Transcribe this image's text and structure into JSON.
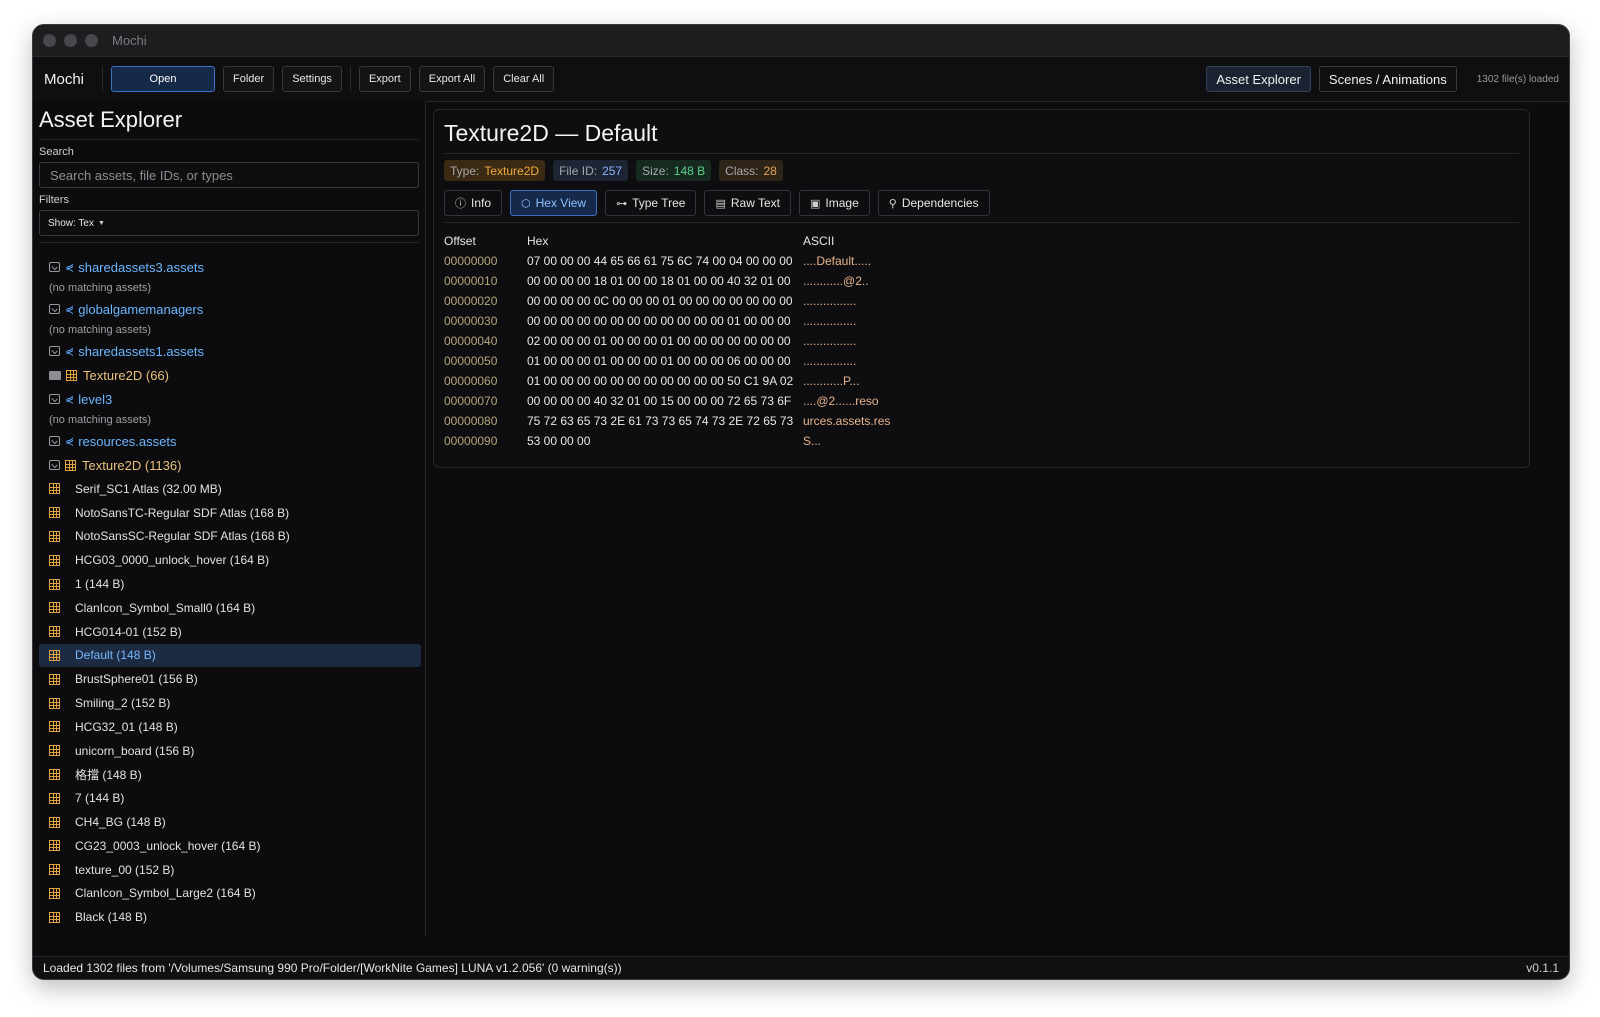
{
  "window": {
    "title": "Mochi"
  },
  "toolbar": {
    "brand": "Mochi",
    "open": "Open",
    "folder": "Folder",
    "settings": "Settings",
    "export": "Export",
    "export_all": "Export All",
    "clear_all": "Clear All",
    "asset_explorer": "Asset Explorer",
    "scenes_animations": "Scenes / Animations",
    "file_count": "1302 file(s) loaded"
  },
  "sidebar": {
    "title": "Asset Explorer",
    "search_label": "Search",
    "search_placeholder": "Search assets, file IDs, or types",
    "filters_label": "Filters",
    "filter_value": "Show: Tex",
    "tree": [
      {
        "kind": "file",
        "label": "sharedassets3.assets"
      },
      {
        "kind": "nomatch",
        "label": "(no matching assets)"
      },
      {
        "kind": "file",
        "label": "globalgamemanagers"
      },
      {
        "kind": "nomatch",
        "label": "(no matching assets)"
      },
      {
        "kind": "file",
        "label": "sharedassets1.assets"
      },
      {
        "kind": "group-closed",
        "label": "Texture2D (66)"
      },
      {
        "kind": "file",
        "label": "level3"
      },
      {
        "kind": "nomatch",
        "label": "(no matching assets)"
      },
      {
        "kind": "file",
        "label": "resources.assets"
      },
      {
        "kind": "group-open",
        "label": "Texture2D (1136)"
      },
      {
        "kind": "leaf",
        "label": "Serif_SC1 Atlas (32.00 MB)"
      },
      {
        "kind": "leaf",
        "label": "NotoSansTC-Regular SDF Atlas (168 B)"
      },
      {
        "kind": "leaf",
        "label": "NotoSansSC-Regular SDF Atlas (168 B)"
      },
      {
        "kind": "leaf",
        "label": "HCG03_0000_unlock_hover (164 B)"
      },
      {
        "kind": "leaf",
        "label": "1 (144 B)"
      },
      {
        "kind": "leaf",
        "label": "ClanIcon_Symbol_Small0 (164 B)"
      },
      {
        "kind": "leaf",
        "label": "HCG014-01 (152 B)"
      },
      {
        "kind": "leaf",
        "label": "Default (148 B)",
        "selected": true
      },
      {
        "kind": "leaf",
        "label": "BrustSphere01 (156 B)"
      },
      {
        "kind": "leaf",
        "label": "Smiling_2 (152 B)"
      },
      {
        "kind": "leaf",
        "label": "HCG32_01 (148 B)"
      },
      {
        "kind": "leaf",
        "label": "unicorn_board (156 B)"
      },
      {
        "kind": "leaf",
        "label": "格擋 (148 B)"
      },
      {
        "kind": "leaf",
        "label": "7 (144 B)"
      },
      {
        "kind": "leaf",
        "label": "CH4_BG (148 B)"
      },
      {
        "kind": "leaf",
        "label": "CG23_0003_unlock_hover (164 B)"
      },
      {
        "kind": "leaf",
        "label": "texture_00 (152 B)"
      },
      {
        "kind": "leaf",
        "label": "ClanIcon_Symbol_Large2 (164 B)"
      },
      {
        "kind": "leaf",
        "label": "Black (148 B)"
      }
    ]
  },
  "main": {
    "title": "Texture2D — Default",
    "badges": {
      "type_key": "Type:",
      "type_val": "Texture2D",
      "fid_key": "File ID:",
      "fid_val": "257",
      "size_key": "Size:",
      "size_val": "148 B",
      "class_key": "Class:",
      "class_val": "28"
    },
    "tabs": [
      {
        "icon": "info-icon",
        "glyph": "ⓘ",
        "label": "Info"
      },
      {
        "icon": "hex-icon",
        "glyph": "⬡",
        "label": "Hex View",
        "active": true
      },
      {
        "icon": "tree-icon",
        "glyph": "⊶",
        "label": "Type Tree"
      },
      {
        "icon": "document-icon",
        "glyph": "▤",
        "label": "Raw Text"
      },
      {
        "icon": "image-icon",
        "glyph": "▣",
        "label": "Image"
      },
      {
        "icon": "dependencies-icon",
        "glyph": "⚲",
        "label": "Dependencies"
      }
    ],
    "hex": {
      "headers": [
        "Offset",
        "Hex",
        "ASCII"
      ],
      "rows": [
        {
          "offset": "00000000",
          "hex": "07 00 00 00 44 65 66 61 75 6C 74 00 04 00 00 00",
          "ascii": "....Default....."
        },
        {
          "offset": "00000010",
          "hex": "00 00 00 00 18 01 00 00 18 01 00 00 40 32 01 00",
          "ascii": "............@2.."
        },
        {
          "offset": "00000020",
          "hex": "00 00 00 00 0C 00 00 00 01 00 00 00 00 00 00 00",
          "ascii": "................"
        },
        {
          "offset": "00000030",
          "hex": "00 00 00 00 00 00 00 00 00 00 00 00 01 00 00 00",
          "ascii": "................"
        },
        {
          "offset": "00000040",
          "hex": "02 00 00 00 01 00 00 00 01 00 00 00 00 00 00 00",
          "ascii": "................"
        },
        {
          "offset": "00000050",
          "hex": "01 00 00 00 01 00 00 00 01 00 00 00 06 00 00 00",
          "ascii": "................"
        },
        {
          "offset": "00000060",
          "hex": "01 00 00 00 00 00 00 00 00 00 00 00 50 C1 9A 02",
          "ascii": "............P..."
        },
        {
          "offset": "00000070",
          "hex": "00 00 00 00 40 32 01 00 15 00 00 00 72 65 73 6F",
          "ascii": "....@2......reso"
        },
        {
          "offset": "00000080",
          "hex": "75 72 63 65 73 2E 61 73 73 65 74 73 2E 72 65 73",
          "ascii": "urces.assets.res"
        },
        {
          "offset": "00000090",
          "hex": "53 00 00 00",
          "ascii": "S..."
        }
      ]
    }
  },
  "status": {
    "message": "Loaded 1302 files from '/Volumes/Samsung 990 Pro/Folder/[WorkNite Games] LUNA v1.2.056' (0 warning(s))",
    "version": "v0.1.1"
  }
}
